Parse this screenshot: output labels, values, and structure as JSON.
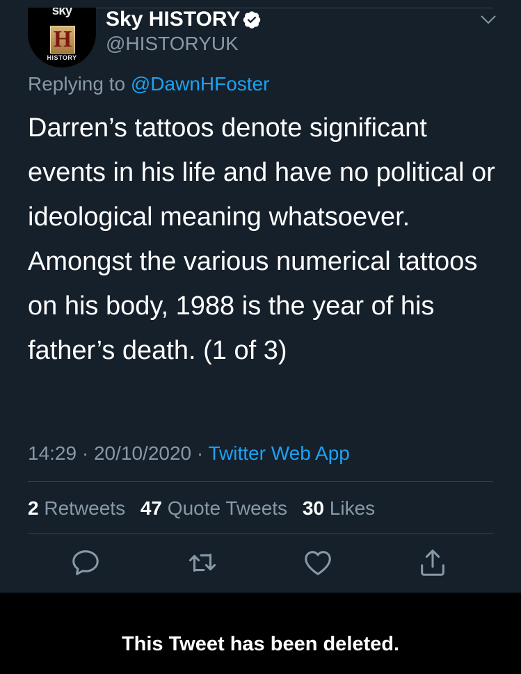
{
  "account": {
    "name": "Sky HISTORY",
    "handle": "@HISTORYUK",
    "avatar_text_top": "sky",
    "avatar_letter": "H",
    "avatar_text_bottom": "HISTORY"
  },
  "reply": {
    "prefix": "Replying to ",
    "mention": "@DawnHFoster"
  },
  "tweet": {
    "text": "Darren’s tattoos denote significant events in his life and have no political or ideological meaning whatsoever. Amongst the various numerical tattoos on his body, 1988 is the year of his father’s death. (1 of 3)",
    "time": "14:29",
    "date": "20/10/2020",
    "separator": " · ",
    "source": "Twitter Web App"
  },
  "stats": {
    "retweets_count": "2",
    "retweets_label": "Retweets",
    "quotes_count": "47",
    "quotes_label": "Quote Tweets",
    "likes_count": "30",
    "likes_label": "Likes"
  },
  "actions": {
    "icons": [
      "reply-icon",
      "retweet-icon",
      "like-icon",
      "share-icon"
    ]
  },
  "banner": {
    "text": "This Tweet has been deleted."
  },
  "colors": {
    "background": "#15202b",
    "accent": "#1da1f2",
    "muted": "#8899a6",
    "divider": "#38444d",
    "banner_background": "#000000"
  }
}
